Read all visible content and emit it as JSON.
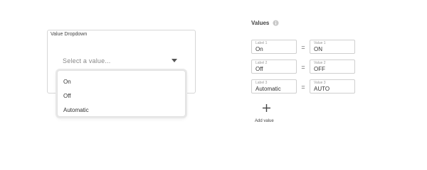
{
  "dropdown": {
    "title": "Value Dropdown",
    "placeholder": "Select a value...",
    "options": [
      "On",
      "Off",
      "Automatic"
    ]
  },
  "values": {
    "header": "Values",
    "rows": [
      {
        "label_caption": "Label 1",
        "label": "On",
        "value_caption": "Value 1",
        "value": "ON"
      },
      {
        "label_caption": "Label 2",
        "label": "Off",
        "value_caption": "Value 2",
        "value": "OFF"
      },
      {
        "label_caption": "Label 3",
        "label": "Automatic",
        "value_caption": "Value 3",
        "value": "AUTO"
      }
    ],
    "equals": "=",
    "add_label": "Add value"
  },
  "icons": {
    "info": "info-icon",
    "chevron": "chevron-down-icon",
    "add": "plus-icon"
  }
}
